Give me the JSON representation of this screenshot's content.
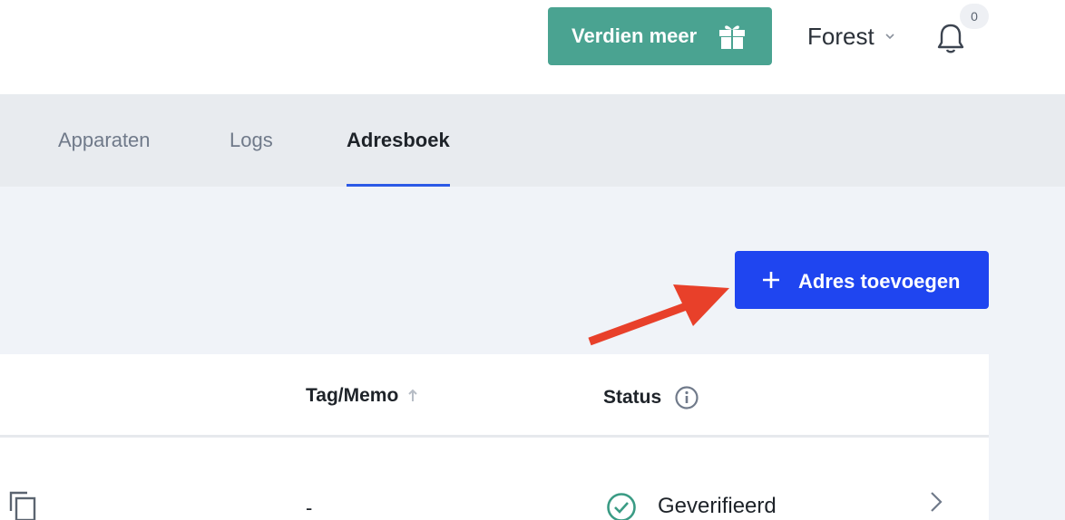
{
  "header": {
    "earn_label": "Verdien meer",
    "user_name": "Forest",
    "notification_count": "0"
  },
  "tabs": [
    {
      "label": "Apparaten",
      "active": false
    },
    {
      "label": "Logs",
      "active": false
    },
    {
      "label": "Adresboek",
      "active": true
    }
  ],
  "actions": {
    "add_address_label": "Adres toevoegen"
  },
  "table": {
    "columns": {
      "tag_memo": "Tag/Memo",
      "status": "Status"
    },
    "rows": [
      {
        "tag_memo": "-",
        "status": "Geverifieerd"
      }
    ]
  },
  "colors": {
    "earn_button": "#4aa391",
    "primary_button": "#1f45f0",
    "tab_underline": "#2b59e6",
    "annotation_arrow": "#e8402a",
    "verified": "#3a9b84"
  },
  "icons": [
    "gift-icon",
    "chevron-down-icon",
    "bell-icon",
    "plus-icon",
    "sort-up-icon",
    "info-icon",
    "copy-icon",
    "check-circle-icon",
    "chevron-right-icon"
  ]
}
